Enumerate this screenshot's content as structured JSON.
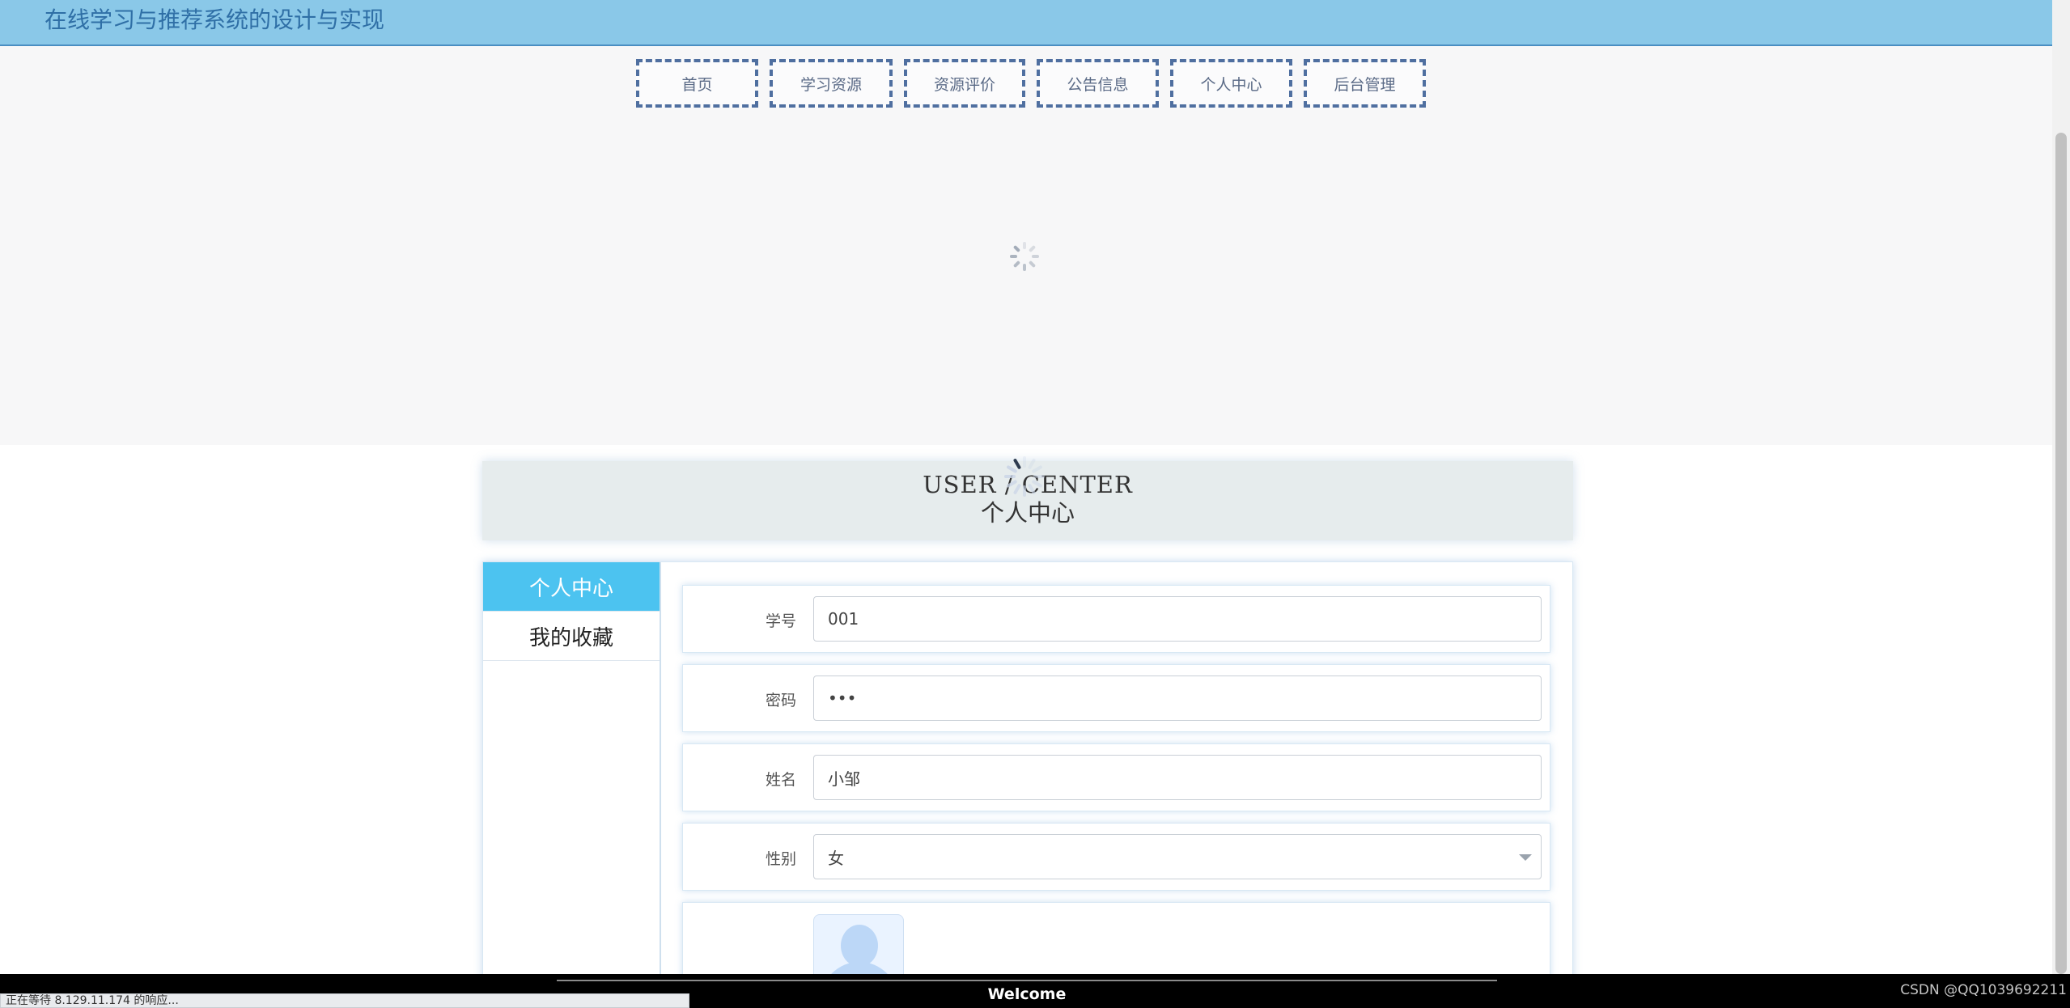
{
  "header": {
    "title": "在线学习与推荐系统的设计与实现"
  },
  "nav": {
    "items": [
      {
        "label": "首页"
      },
      {
        "label": "学习资源"
      },
      {
        "label": "资源评价"
      },
      {
        "label": "公告信息"
      },
      {
        "label": "个人中心"
      },
      {
        "label": "后台管理"
      }
    ]
  },
  "user_center": {
    "title_en": "USER / CENTER",
    "title_cn": "个人中心"
  },
  "sidebar": {
    "items": [
      {
        "label": "个人中心",
        "active": true
      },
      {
        "label": "我的收藏",
        "active": false
      }
    ]
  },
  "form": {
    "student_id": {
      "label": "学号",
      "value": "001"
    },
    "password": {
      "label": "密码",
      "value": "•••"
    },
    "name": {
      "label": "姓名",
      "value": "小邹"
    },
    "gender": {
      "label": "性别",
      "value": "女"
    }
  },
  "footer": {
    "welcome": "Welcome"
  },
  "status": {
    "text": "正在等待 8.129.11.174 的响应..."
  },
  "watermark": {
    "text": "CSDN @QQ1039692211"
  },
  "colors": {
    "header_bg": "#8ac8e8",
    "accent": "#4cc3f0",
    "nav_border": "#4f6fa0"
  }
}
